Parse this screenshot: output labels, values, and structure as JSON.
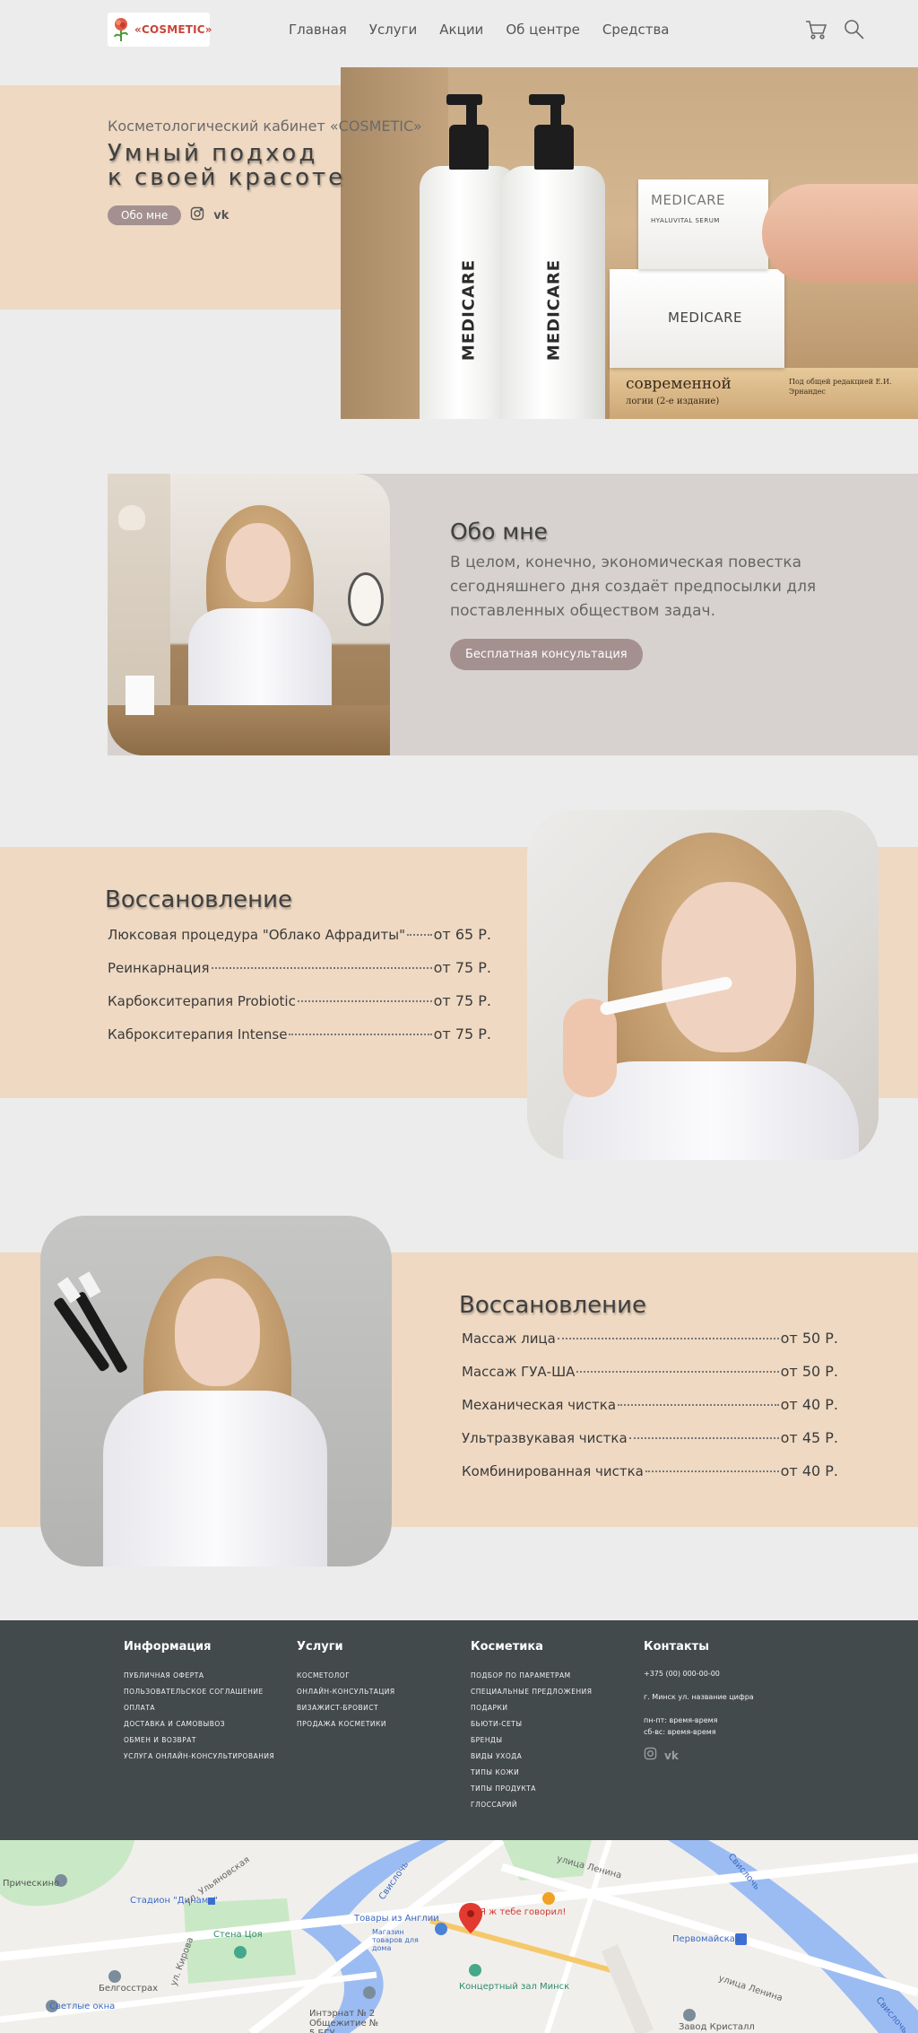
{
  "header": {
    "logo_text": "«COSMETIC»",
    "nav": [
      "Главная",
      "Услуги",
      "Акции",
      "Об центре",
      "Средства"
    ],
    "cart_icon": "cart-icon",
    "search_icon": "search-icon"
  },
  "hero": {
    "subtitle": "Косметологический кабинет «COSMETIC»",
    "title_line1": "Умный подход",
    "title_line2": "к своей красоте",
    "about_button": "Обо мне",
    "social": [
      "instagram-icon",
      "vk-icon"
    ],
    "photo_brand_1": "MEDICARE",
    "photo_brand_2": "MEDICARE",
    "photo_box_small": "MEDICARE",
    "photo_box_small_sub": "HYALUVITAL SERUM",
    "photo_box_big": "MEDICARE",
    "photo_book_1": "современной",
    "photo_book_2": "логии (2-е издание)",
    "photo_book_3": "Под общей редакцией Е.И. Эрнандес"
  },
  "about": {
    "title": "Обо мне",
    "text": "В целом, конечно, экономическая повестка сегодняшнего дня создаёт предпосылки для поставленных обществом задач.",
    "button": "Бесплатная консультация"
  },
  "services1": {
    "title": "Воссановление",
    "items": [
      {
        "name": "Люксовая процедура \"Облако Афрадиты\"",
        "price": "от 65 Р."
      },
      {
        "name": "Реинкарнация",
        "price": "от 75 Р."
      },
      {
        "name": "Карбокситерапия Probiotic",
        "price": "от 75 Р."
      },
      {
        "name": "Каброкситерапия Intense",
        "price": "от 75 Р."
      }
    ]
  },
  "services2": {
    "title": "Воссановление",
    "items": [
      {
        "name": "Массаж лица",
        "price": "от 50 Р."
      },
      {
        "name": "Массаж ГУА-ША",
        "price": "от 50 Р."
      },
      {
        "name": "Механическая чистка",
        "price": "от 40 Р."
      },
      {
        "name": "Ультразвукавая чистка",
        "price": "от 45 Р."
      },
      {
        "name": "Комбинированная чистка",
        "price": "от 40 Р."
      }
    ]
  },
  "footer": {
    "info": {
      "title": "Информация",
      "items": [
        "ПУБЛИЧНАЯ ОФЕРТА",
        "ПОЛЬЗОВАТЕЛЬСКОЕ СОГЛАШЕНИЕ",
        "ОПЛАТА",
        "ДОСТАВКА И САМОВЫВОЗ",
        "ОБМЕН И ВОЗВРАТ",
        "УСЛУГА ОНЛАЙН-КОНСУЛЬТИРОВАНИЯ"
      ]
    },
    "services": {
      "title": "Услуги",
      "items": [
        "КОСМЕТОЛОГ",
        "ОНЛАЙН-КОНСУЛЬТАЦИЯ",
        "ВИЗАЖИСТ-БРОВИСТ",
        "ПРОДАЖА КОСМЕТИКИ"
      ]
    },
    "cosmetics": {
      "title": "Косметика",
      "items": [
        "ПОДБОР ПО ПАРАМЕТРАМ",
        "СПЕЦИАЛЬНЫЕ ПРЕДЛОЖЕНИЯ",
        "ПОДАРКИ",
        "БЬЮТИ-СЕТЫ",
        "БРЕНДЫ",
        "ВИДЫ УХОДА",
        "ТИПЫ КОЖИ",
        "ТИПЫ ПРОДУКТА",
        "ГЛОССАРИЙ"
      ]
    },
    "contacts": {
      "title": "Контакты",
      "phone": "+375 (00) 000-00-00",
      "address": "г. Минск ул. название цифра",
      "hours1": "пн-пт: время-время",
      "hours2": "сб-вс: время-время"
    }
  },
  "map": {
    "labels": {
      "a": "Прическино",
      "b": "Стадион \"Динамо\"",
      "c": "ул. Ульяновская",
      "d": "Свислочь",
      "e": "улица Ленина",
      "f": "Свислочь",
      "g": "Стена Цоя",
      "h": "Магазин товаров для дома",
      "i": "Товары из Англии",
      "j": "Я ж тебе говорил!",
      "k": "Первомайская",
      "l": "Белгосстрах",
      "m": "ул. Кирова",
      "n": "Концертный зал Минск",
      "o": "Интэрнат № 2 Общежитие № 5 БГУ",
      "p": "Светлые окна",
      "q": "Завод Кристалл",
      "r": "улица Ленина",
      "s": "Свислочь"
    },
    "accent_road": "#f5c86a",
    "accent_water": "#9bbcf2"
  }
}
